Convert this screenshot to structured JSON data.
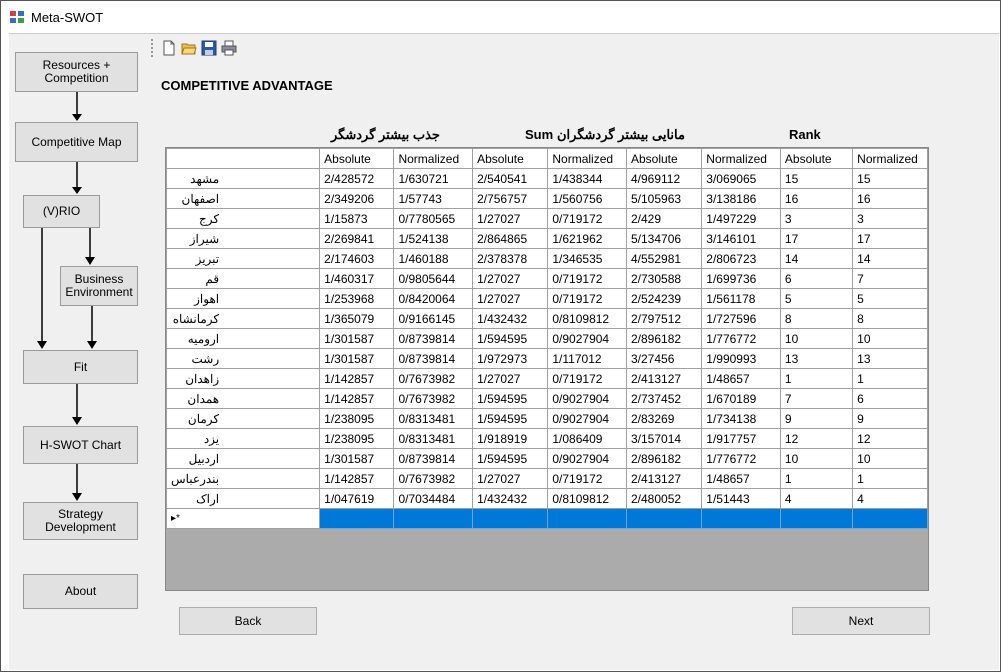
{
  "window": {
    "title": "Meta-SWOT"
  },
  "nav": {
    "resources": "Resources +\nCompetition",
    "competitive_map": "Competitive Map",
    "vrio": "(V)RIO",
    "business_env": "Business\nEnvironment",
    "fit": "Fit",
    "hswot": "H-SWOT Chart",
    "strategy": "Strategy\nDevelopment",
    "about": "About"
  },
  "toolbar": {
    "icons": [
      "new-icon",
      "open-icon",
      "save-icon",
      "print-icon"
    ]
  },
  "section_title": "COMPETITIVE ADVANTAGE",
  "group_headers": {
    "g1": "جذب بیشتر گردشگر",
    "g2": "مانایی بیشتر گردشگران",
    "sum": "Sum",
    "rank": "Rank"
  },
  "table": {
    "columns": [
      "",
      "Absolute",
      "Normalized",
      "Absolute",
      "Normalized",
      "Absolute",
      "Normalized",
      "Absolute",
      "Normalized"
    ],
    "rows": [
      [
        "مشهد",
        "2/428572",
        "1/630721",
        "2/540541",
        "1/438344",
        "4/969112",
        "3/069065",
        "15",
        "15"
      ],
      [
        "اصفهان",
        "2/349206",
        "1/57743",
        "2/756757",
        "1/560756",
        "5/105963",
        "3/138186",
        "16",
        "16"
      ],
      [
        "کرج",
        "1/15873",
        "0/7780565",
        "1/27027",
        "0/719172",
        "2/429",
        "1/497229",
        "3",
        "3"
      ],
      [
        "شیراز",
        "2/269841",
        "1/524138",
        "2/864865",
        "1/621962",
        "5/134706",
        "3/146101",
        "17",
        "17"
      ],
      [
        "تبریز",
        "2/174603",
        "1/460188",
        "2/378378",
        "1/346535",
        "4/552981",
        "2/806723",
        "14",
        "14"
      ],
      [
        "قم",
        "1/460317",
        "0/9805644",
        "1/27027",
        "0/719172",
        "2/730588",
        "1/699736",
        "6",
        "7"
      ],
      [
        "اهواز",
        "1/253968",
        "0/8420064",
        "1/27027",
        "0/719172",
        "2/524239",
        "1/561178",
        "5",
        "5"
      ],
      [
        "کرمانشاه",
        "1/365079",
        "0/9166145",
        "1/432432",
        "0/8109812",
        "2/797512",
        "1/727596",
        "8",
        "8"
      ],
      [
        "ارومیه",
        "1/301587",
        "0/8739814",
        "1/594595",
        "0/9027904",
        "2/896182",
        "1/776772",
        "10",
        "10"
      ],
      [
        "رشت",
        "1/301587",
        "0/8739814",
        "1/972973",
        "1/117012",
        "3/27456",
        "1/990993",
        "13",
        "13"
      ],
      [
        "زاهدان",
        "1/142857",
        "0/7673982",
        "1/27027",
        "0/719172",
        "2/413127",
        "1/48657",
        "1",
        "1"
      ],
      [
        "همدان",
        "1/142857",
        "0/7673982",
        "1/594595",
        "0/9027904",
        "2/737452",
        "1/670189",
        "7",
        "6"
      ],
      [
        "کرمان",
        "1/238095",
        "0/8313481",
        "1/594595",
        "0/9027904",
        "2/83269",
        "1/734138",
        "9",
        "9"
      ],
      [
        "یزد",
        "1/238095",
        "0/8313481",
        "1/918919",
        "1/086409",
        "3/157014",
        "1/917757",
        "12",
        "12"
      ],
      [
        "اردبیل",
        "1/301587",
        "0/8739814",
        "1/594595",
        "0/9027904",
        "2/896182",
        "1/776772",
        "10",
        "10"
      ],
      [
        "بندرعباس",
        "1/142857",
        "0/7673982",
        "1/27027",
        "0/719172",
        "2/413127",
        "1/48657",
        "1",
        "1"
      ],
      [
        "اراک",
        "1/047619",
        "0/7034484",
        "1/432432",
        "0/8109812",
        "2/480052",
        "1/51443",
        "4",
        "4"
      ]
    ],
    "new_row_marker": "▸*"
  },
  "buttons": {
    "back": "Back",
    "next": "Next"
  },
  "colors": {
    "selection": "#0078d7",
    "button_face": "#e1e1e1",
    "client_bg": "#f0f0f0"
  }
}
